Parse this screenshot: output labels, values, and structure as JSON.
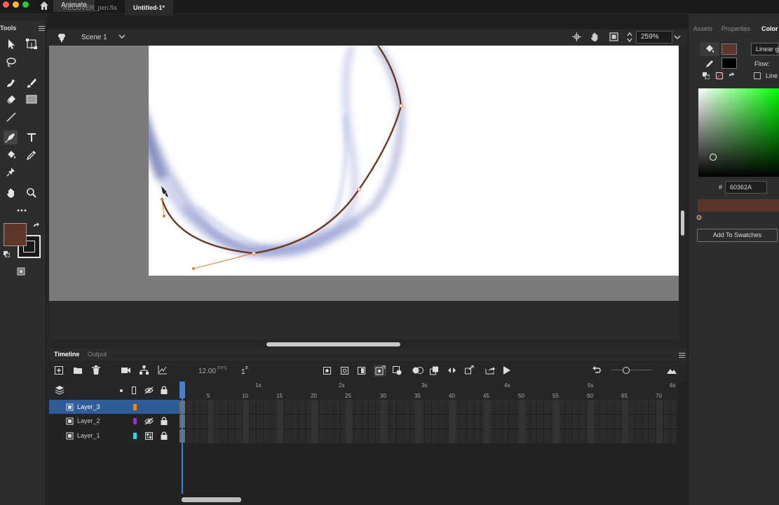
{
  "titlebar": {
    "app_tab": "Animate"
  },
  "doc_tabs": [
    "RECOVER_pen.fla",
    "Untitled-1*"
  ],
  "edit_bar": {
    "scene": "Scene 1",
    "zoom": "259%"
  },
  "tools_panel": {
    "title": "Tools"
  },
  "right_panel": {
    "tabs": [
      "Assets",
      "Properties",
      "Color"
    ],
    "fill_type": "Linear g",
    "flow_label": "Flow:",
    "linear_label": "Line",
    "hex_prefix": "#",
    "hex_value": "60362A",
    "add_swatch": "Add To Swatches"
  },
  "timeline": {
    "tabs": [
      "Timeline",
      "Output"
    ],
    "fps": "12.00",
    "fps_unit": "FPS",
    "frame": "1",
    "frame_unit": "F",
    "seconds": [
      "1s",
      "2s",
      "3s",
      "4s",
      "5s",
      "6s"
    ],
    "frame_numbers": [
      "5",
      "10",
      "15",
      "20",
      "25",
      "30",
      "35",
      "40",
      "45",
      "50",
      "55",
      "60",
      "65",
      "70"
    ],
    "layers": [
      {
        "name": "Layer_3",
        "color": "#e8862a",
        "selected": true
      },
      {
        "name": "Layer_2",
        "color": "#9b2fc9",
        "selected": false
      },
      {
        "name": "Layer_1",
        "color": "#2fd6e8",
        "selected": false
      }
    ]
  },
  "colors": {
    "fill": "#60362A",
    "stroke": "#000000",
    "accent": "#3c7fd8",
    "curve": "#6a3a22",
    "handle": "#e07a30"
  }
}
